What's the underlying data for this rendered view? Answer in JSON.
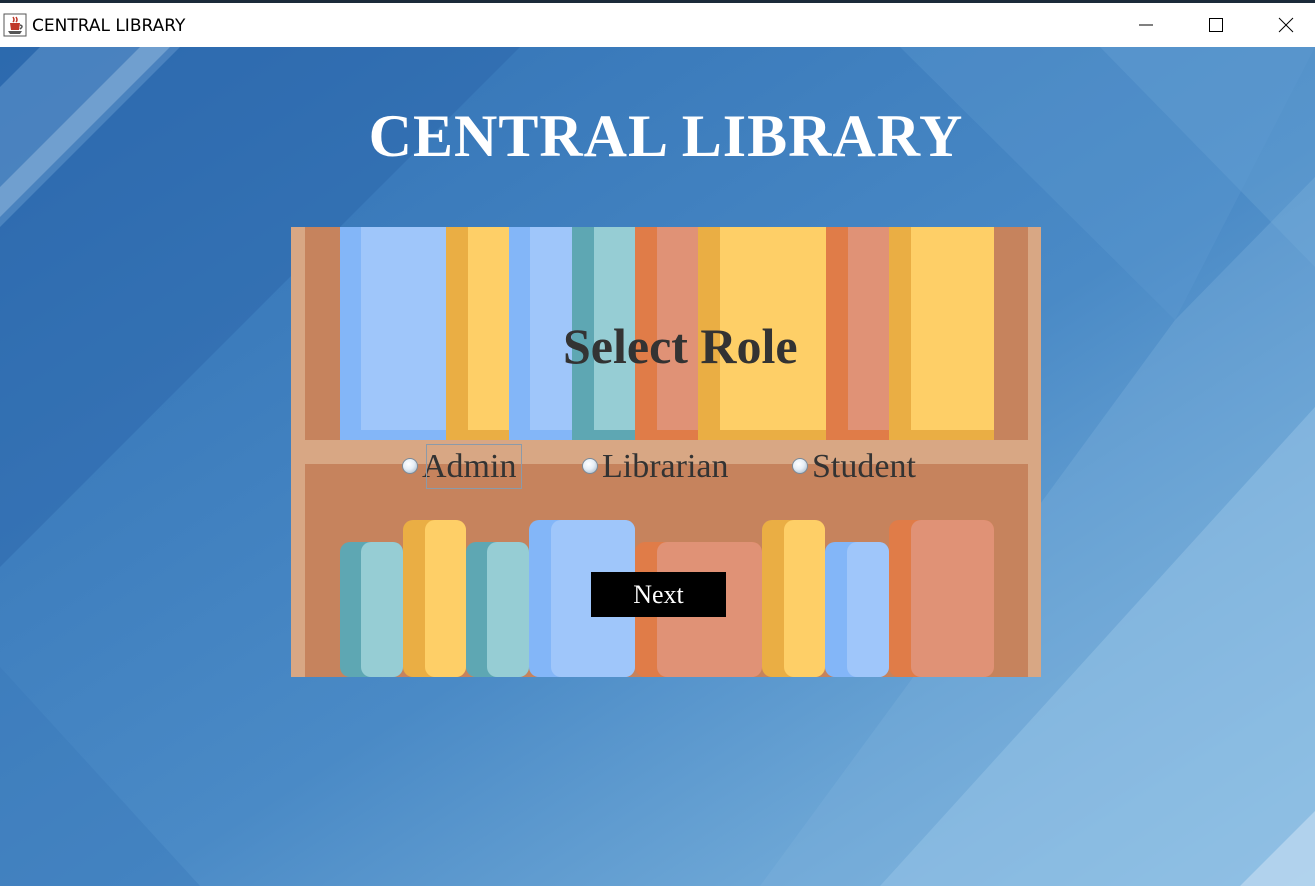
{
  "window": {
    "title": "CENTRAL LIBRARY",
    "app_icon": "java-cup-icon",
    "controls": [
      "minimize-icon",
      "maximize-icon",
      "close-icon"
    ]
  },
  "main": {
    "title": "CENTRAL LIBRARY",
    "prompt": "Select Role",
    "roles": [
      {
        "label": "Admin",
        "selected": false,
        "focused": true
      },
      {
        "label": "Librarian",
        "selected": false,
        "focused": false
      },
      {
        "label": "Student",
        "selected": false,
        "focused": false
      }
    ],
    "next_label": "Next"
  },
  "colors": {
    "background": "#3f84c4",
    "shelf_wood": "#c6835d",
    "shelf_frame": "#d8a784",
    "book_blue": "#9fc6fa",
    "book_yellow": "#fecf67",
    "book_teal": "#96cdd4",
    "book_salmon": "#e09276",
    "button_bg": "#000000",
    "title_text": "#ffffff",
    "label_text": "#333333"
  }
}
